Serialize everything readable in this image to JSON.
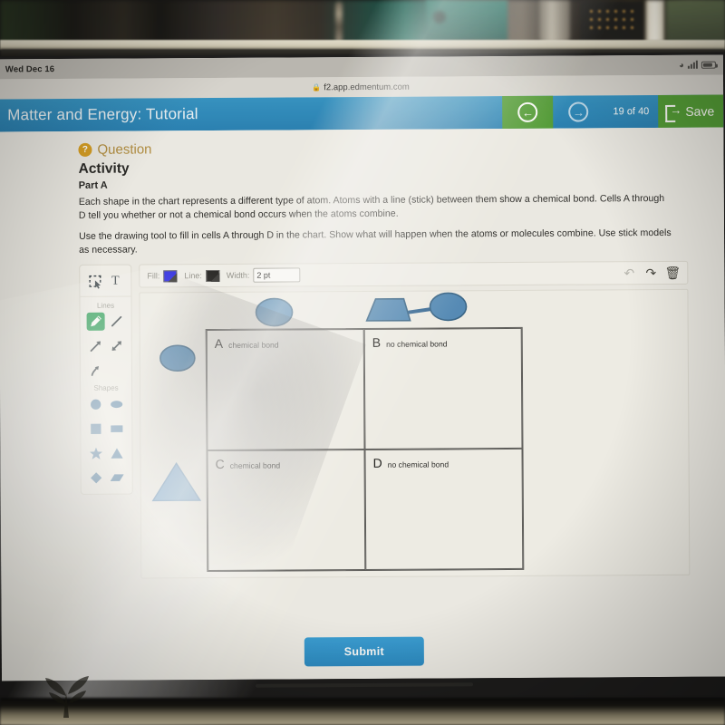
{
  "device": {
    "status_bar": {
      "day_time": "Wed Dec 16",
      "wifi_icon": "wifi-icon",
      "signal_icon": "cellular-signal-icon",
      "battery_icon": "battery-icon"
    },
    "browser": {
      "lock_icon": "lock-icon",
      "url": "f2.app.edmentum.com"
    }
  },
  "header": {
    "title": "Matter and Energy: Tutorial",
    "prev_icon": "arrow-left-circle-icon",
    "next_icon": "arrow-right-circle-icon",
    "pager_current": "19",
    "pager_of": "of",
    "pager_total": "40",
    "save_label": "Save",
    "save_icon": "exit-arrow-icon",
    "accent_blue": "#1d7cb4",
    "accent_green": "#4a9a2e"
  },
  "question": {
    "badge_icon": "question-mark-icon",
    "badge_label": "Question",
    "heading": "Activity",
    "part": "Part A",
    "paragraph1": "Each shape in the chart represents a different type of atom. Atoms with a line (stick) between them show a chemical bond. Cells A through D tell you whether or not a chemical bond occurs when the atoms combine.",
    "paragraph2": "Use the drawing tool to fill in cells A through D in the chart. Show what will happen when the atoms or molecules combine. Use stick models as necessary."
  },
  "palette": {
    "select_tool": "select-marquee-icon",
    "text_tool": "T",
    "lines_label": "Lines",
    "lines": [
      {
        "name": "freehand-pencil-tool",
        "selected": true
      },
      {
        "name": "straight-line-tool",
        "selected": false
      },
      {
        "name": "single-arrow-tool",
        "selected": false
      },
      {
        "name": "double-arrow-tool",
        "selected": false
      },
      {
        "name": "curved-arrow-tool",
        "selected": false
      }
    ],
    "shapes_label": "Shapes",
    "shapes": [
      {
        "name": "circle-shape-tool"
      },
      {
        "name": "ellipse-shape-tool"
      },
      {
        "name": "square-shape-tool"
      },
      {
        "name": "rectangle-shape-tool"
      },
      {
        "name": "star-shape-tool"
      },
      {
        "name": "triangle-shape-tool"
      },
      {
        "name": "diamond-shape-tool"
      },
      {
        "name": "parallelogram-shape-tool"
      }
    ],
    "selected_color": "#2aa05a"
  },
  "toolbar": {
    "fill_label": "Fill:",
    "fill_color": "#1a18e8",
    "line_label": "Line:",
    "line_color": "#111111",
    "width_label": "Width:",
    "width_value": "2 pt",
    "undo_icon": "undo-arrow-icon",
    "redo_icon": "redo-arrow-icon",
    "delete_icon": "trash-can-icon"
  },
  "chart": {
    "column_headers": [
      {
        "name": "circle-atom-header",
        "shape": "ellipse"
      },
      {
        "name": "molecule-header",
        "shape": "trapezoid-bond-ellipse"
      }
    ],
    "row_headers": [
      {
        "name": "circle-atom-row-header",
        "shape": "ellipse"
      },
      {
        "name": "triangle-atom-row-header",
        "shape": "triangle"
      }
    ],
    "cells": [
      {
        "letter": "A",
        "text": "chemical bond"
      },
      {
        "letter": "B",
        "text": "no chemical bond"
      },
      {
        "letter": "C",
        "text": "chemical bond"
      },
      {
        "letter": "D",
        "text": "no chemical bond"
      }
    ],
    "shape_fill": "#4c87b8",
    "shape_stroke": "#2f5f86"
  },
  "footer": {
    "submit_label": "Submit",
    "submit_color": "#1f86c4"
  }
}
